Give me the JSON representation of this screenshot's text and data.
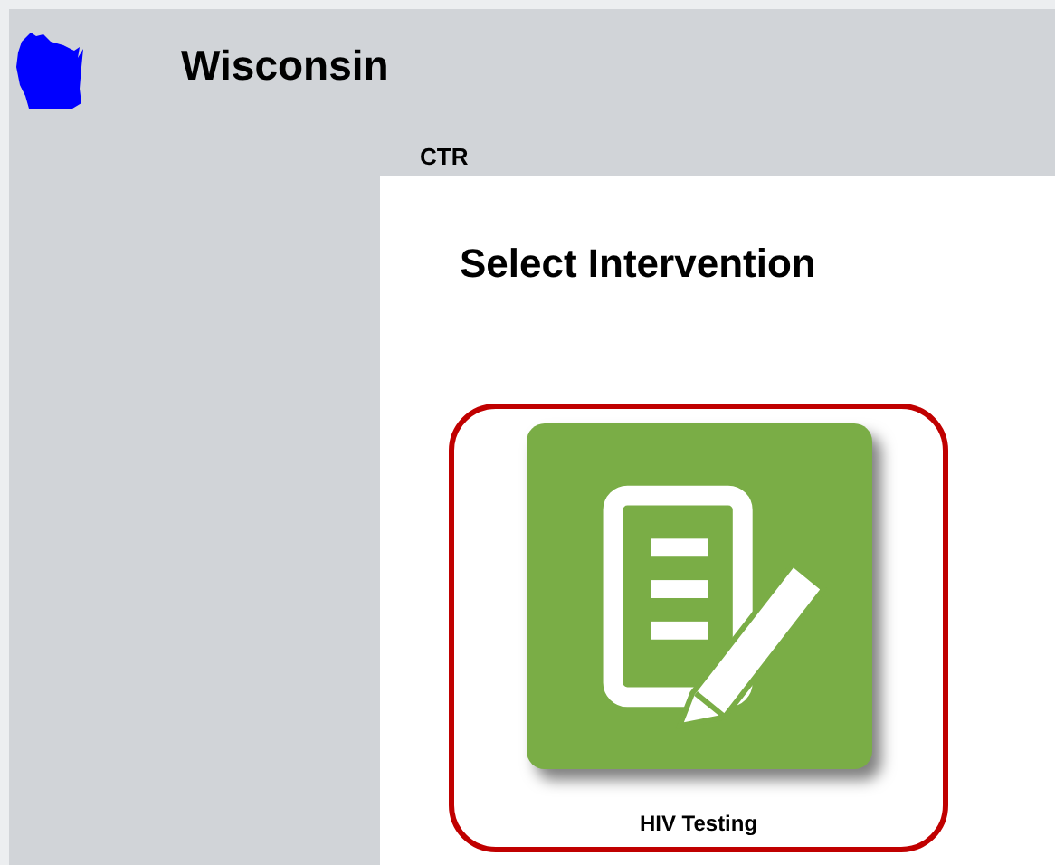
{
  "header": {
    "title": "Wisconsin",
    "subtitle": "CTR"
  },
  "panel": {
    "title": "Select Intervention",
    "interventions": [
      {
        "label": "HIV Testing",
        "selected": true
      }
    ]
  }
}
